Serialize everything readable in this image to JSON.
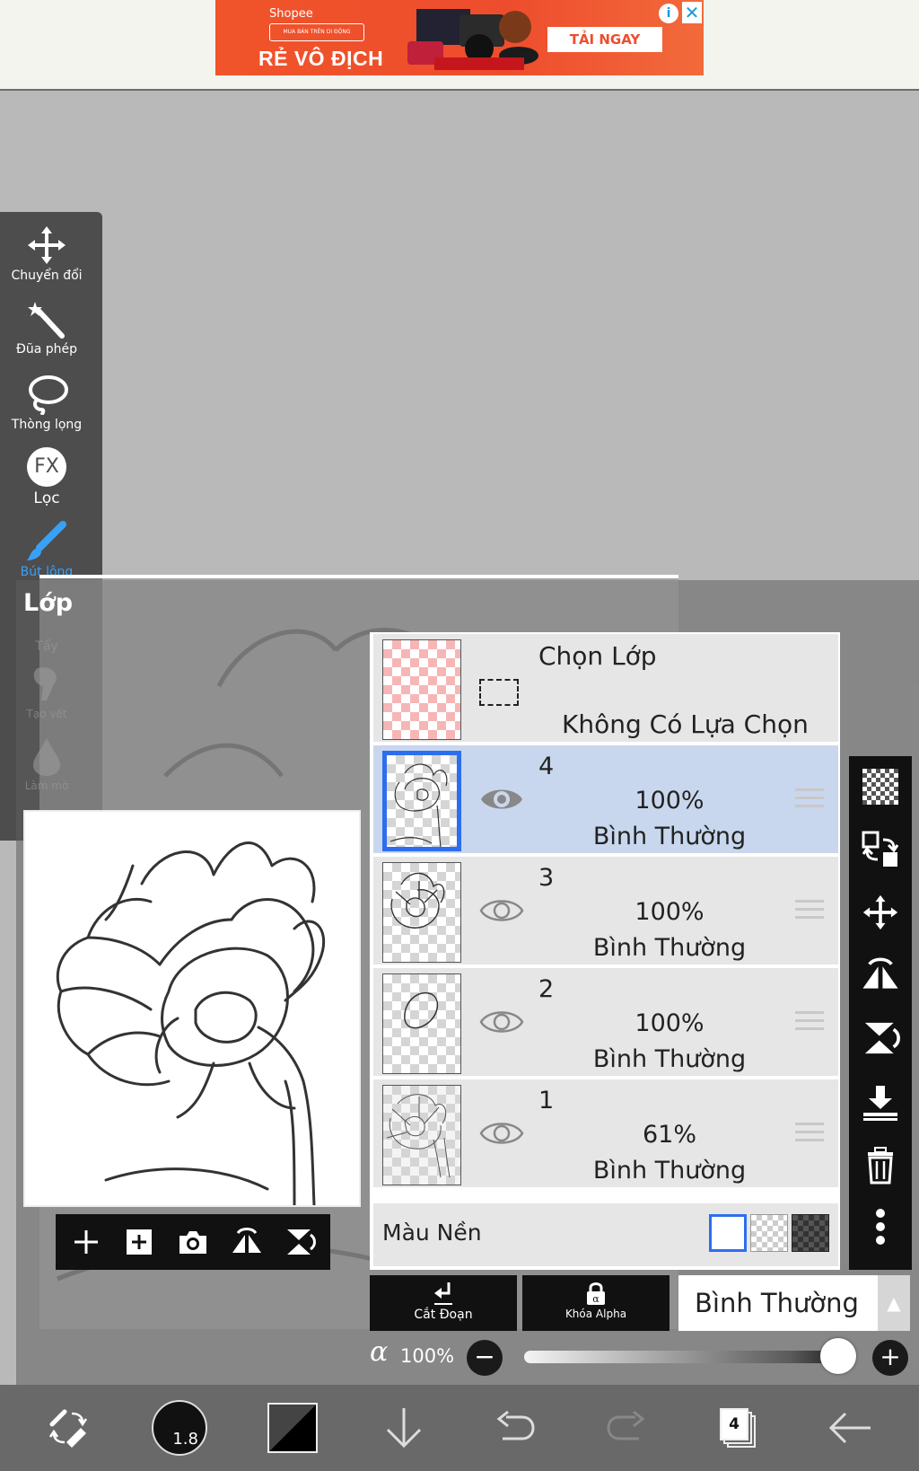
{
  "ad": {
    "brand": "Shopee",
    "brand_sub": "MUA BÁN TRÊN DI ĐỘNG",
    "tagline": "RẺ VÔ ĐỊCH",
    "cta": "TẢI NGAY",
    "info_glyph": "i",
    "close_glyph": "✕",
    "colors": {
      "background": "#ee4d2d",
      "accent": "#1a9ad6"
    }
  },
  "tools": [
    {
      "label": "Chuyển đổi",
      "icon": "move-arrows-icon"
    },
    {
      "label": "Đũa phép",
      "icon": "magic-wand-icon"
    },
    {
      "label": "Thòng lọng",
      "icon": "lasso-icon"
    },
    {
      "label": "Lọc",
      "icon": "fx-filter-icon",
      "glyph": "FX"
    },
    {
      "label": "Bút lông",
      "icon": "brush-icon",
      "active": true
    },
    {
      "label": "Tẩy",
      "icon": "eraser-icon"
    },
    {
      "label": "Tạo vết",
      "icon": "smudge-icon"
    },
    {
      "label": "Làm mờ",
      "icon": "blur-drop-icon"
    }
  ],
  "layer_panel": {
    "title": "Lớp",
    "selection": {
      "title": "Chọn Lớp",
      "subtitle": "Không Có Lựa Chọn"
    },
    "layers": [
      {
        "number": "4",
        "opacity": "100%",
        "mode": "Bình Thường",
        "selected": true,
        "visible": true
      },
      {
        "number": "3",
        "opacity": "100%",
        "mode": "Bình Thường",
        "selected": false,
        "visible": true
      },
      {
        "number": "2",
        "opacity": "100%",
        "mode": "Bình Thường",
        "selected": false,
        "visible": true
      },
      {
        "number": "1",
        "opacity": "61%",
        "mode": "Bình Thường",
        "selected": false,
        "visible": true
      }
    ],
    "background": {
      "label": "Màu Nền",
      "options": [
        "white",
        "transparent",
        "dark"
      ],
      "selected": "white"
    },
    "clip_label": "Cắt Đoạn",
    "alpha_lock_label": "Khóa Alpha",
    "blend_mode": "Bình Thường",
    "opacity": {
      "symbol": "α",
      "value": "100%",
      "fraction": 1.0
    },
    "minus": "−",
    "plus": "+",
    "accent": "#2d6ef0"
  },
  "preview_toolbar": [
    "add-layer-icon",
    "add-layer-box-icon",
    "camera-icon",
    "flip-horizontal-icon",
    "flip-vertical-icon"
  ],
  "right_tools": [
    "transparency-checker-icon",
    "swap-layers-icon",
    "move-arrows-icon",
    "flip-horizontal-icon",
    "flip-vertical-icon",
    "merge-down-icon",
    "trash-icon",
    "more-vertical-icon"
  ],
  "bottom_bar": {
    "brush_size": "1.8",
    "layer_count": "4",
    "colors": {
      "bar": "#696969"
    }
  }
}
